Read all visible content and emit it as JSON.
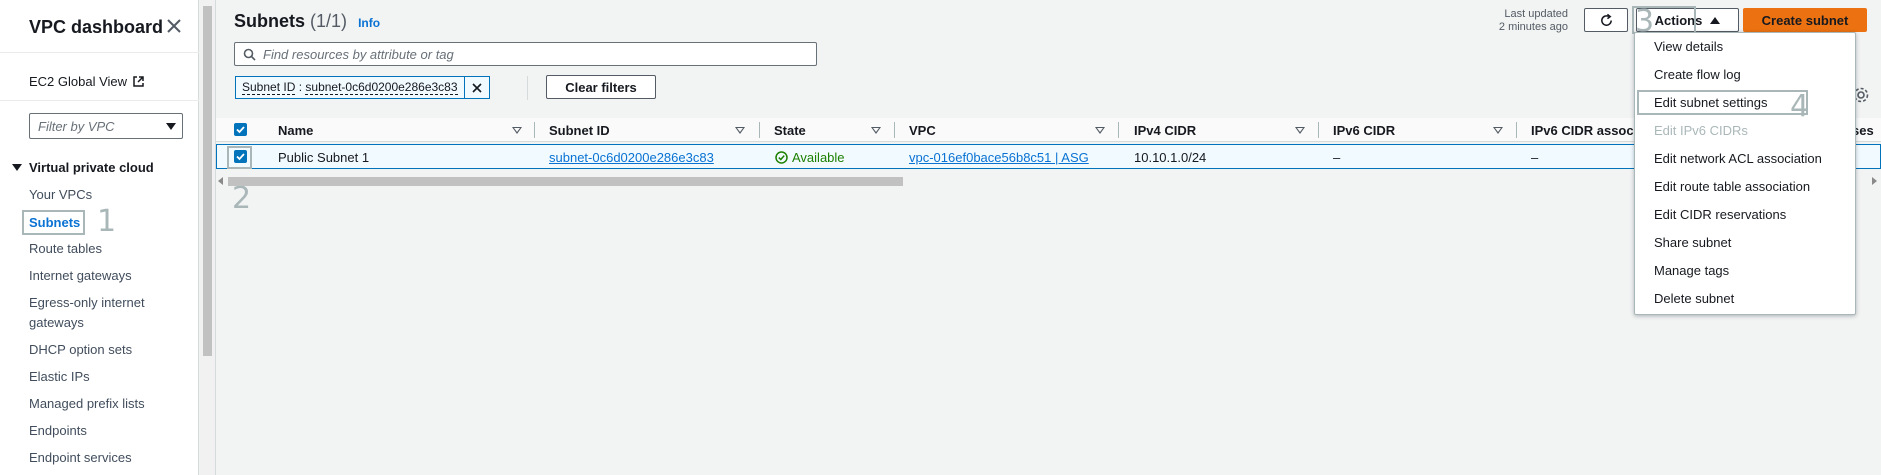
{
  "sidebar": {
    "title": "VPC dashboard",
    "ec2_link": "EC2 Global View",
    "filter_placeholder": "Filter by VPC",
    "section": "Virtual private cloud",
    "items": [
      {
        "label": "Your VPCs"
      },
      {
        "label": "Subnets"
      },
      {
        "label": "Route tables"
      },
      {
        "label": "Internet gateways"
      },
      {
        "label": "Egress-only internet gateways"
      },
      {
        "label": "DHCP option sets"
      },
      {
        "label": "Elastic IPs"
      },
      {
        "label": "Managed prefix lists"
      },
      {
        "label": "Endpoints"
      },
      {
        "label": "Endpoint services"
      }
    ]
  },
  "header": {
    "title": "Subnets",
    "count": "(1/1)",
    "info": "Info",
    "last_updated_line1": "Last updated",
    "last_updated_line2": "2 minutes ago",
    "actions_label": "Actions",
    "create_label": "Create subnet"
  },
  "search": {
    "placeholder": "Find resources by attribute or tag",
    "token_key": "Subnet ID",
    "token_sep": " : ",
    "token_value": "subnet-0c6d0200e286e3c83",
    "clear_label": "Clear filters"
  },
  "table": {
    "columns": [
      "Name",
      "Subnet ID",
      "State",
      "VPC",
      "IPv4 CIDR",
      "IPv6 CIDR",
      "IPv6 CIDR associa",
      "ses"
    ],
    "rows": [
      {
        "name": "Public Subnet 1",
        "subnet_id": "subnet-0c6d0200e286e3c83",
        "state": "Available",
        "vpc": "vpc-016ef0bace56b8c51 | ASG",
        "ipv4": "10.10.1.0/24",
        "ipv6": "–",
        "ipv6_assoc": "–"
      }
    ]
  },
  "menu": {
    "items": [
      {
        "label": "View details",
        "disabled": false
      },
      {
        "label": "Create flow log",
        "disabled": false
      },
      {
        "label": "Edit subnet settings",
        "disabled": false
      },
      {
        "label": "Edit IPv6 CIDRs",
        "disabled": true
      },
      {
        "label": "Edit network ACL association",
        "disabled": false
      },
      {
        "label": "Edit route table association",
        "disabled": false
      },
      {
        "label": "Edit CIDR reservations",
        "disabled": false
      },
      {
        "label": "Share subnet",
        "disabled": false
      },
      {
        "label": "Manage tags",
        "disabled": false
      },
      {
        "label": "Delete subnet",
        "disabled": false
      }
    ]
  },
  "annotations": [
    "1",
    "2",
    "3",
    "4"
  ],
  "colors": {
    "accent": "#0972d3",
    "primary_button": "#ec7211",
    "available": "#1d8102",
    "selection_border": "#0073bb"
  }
}
